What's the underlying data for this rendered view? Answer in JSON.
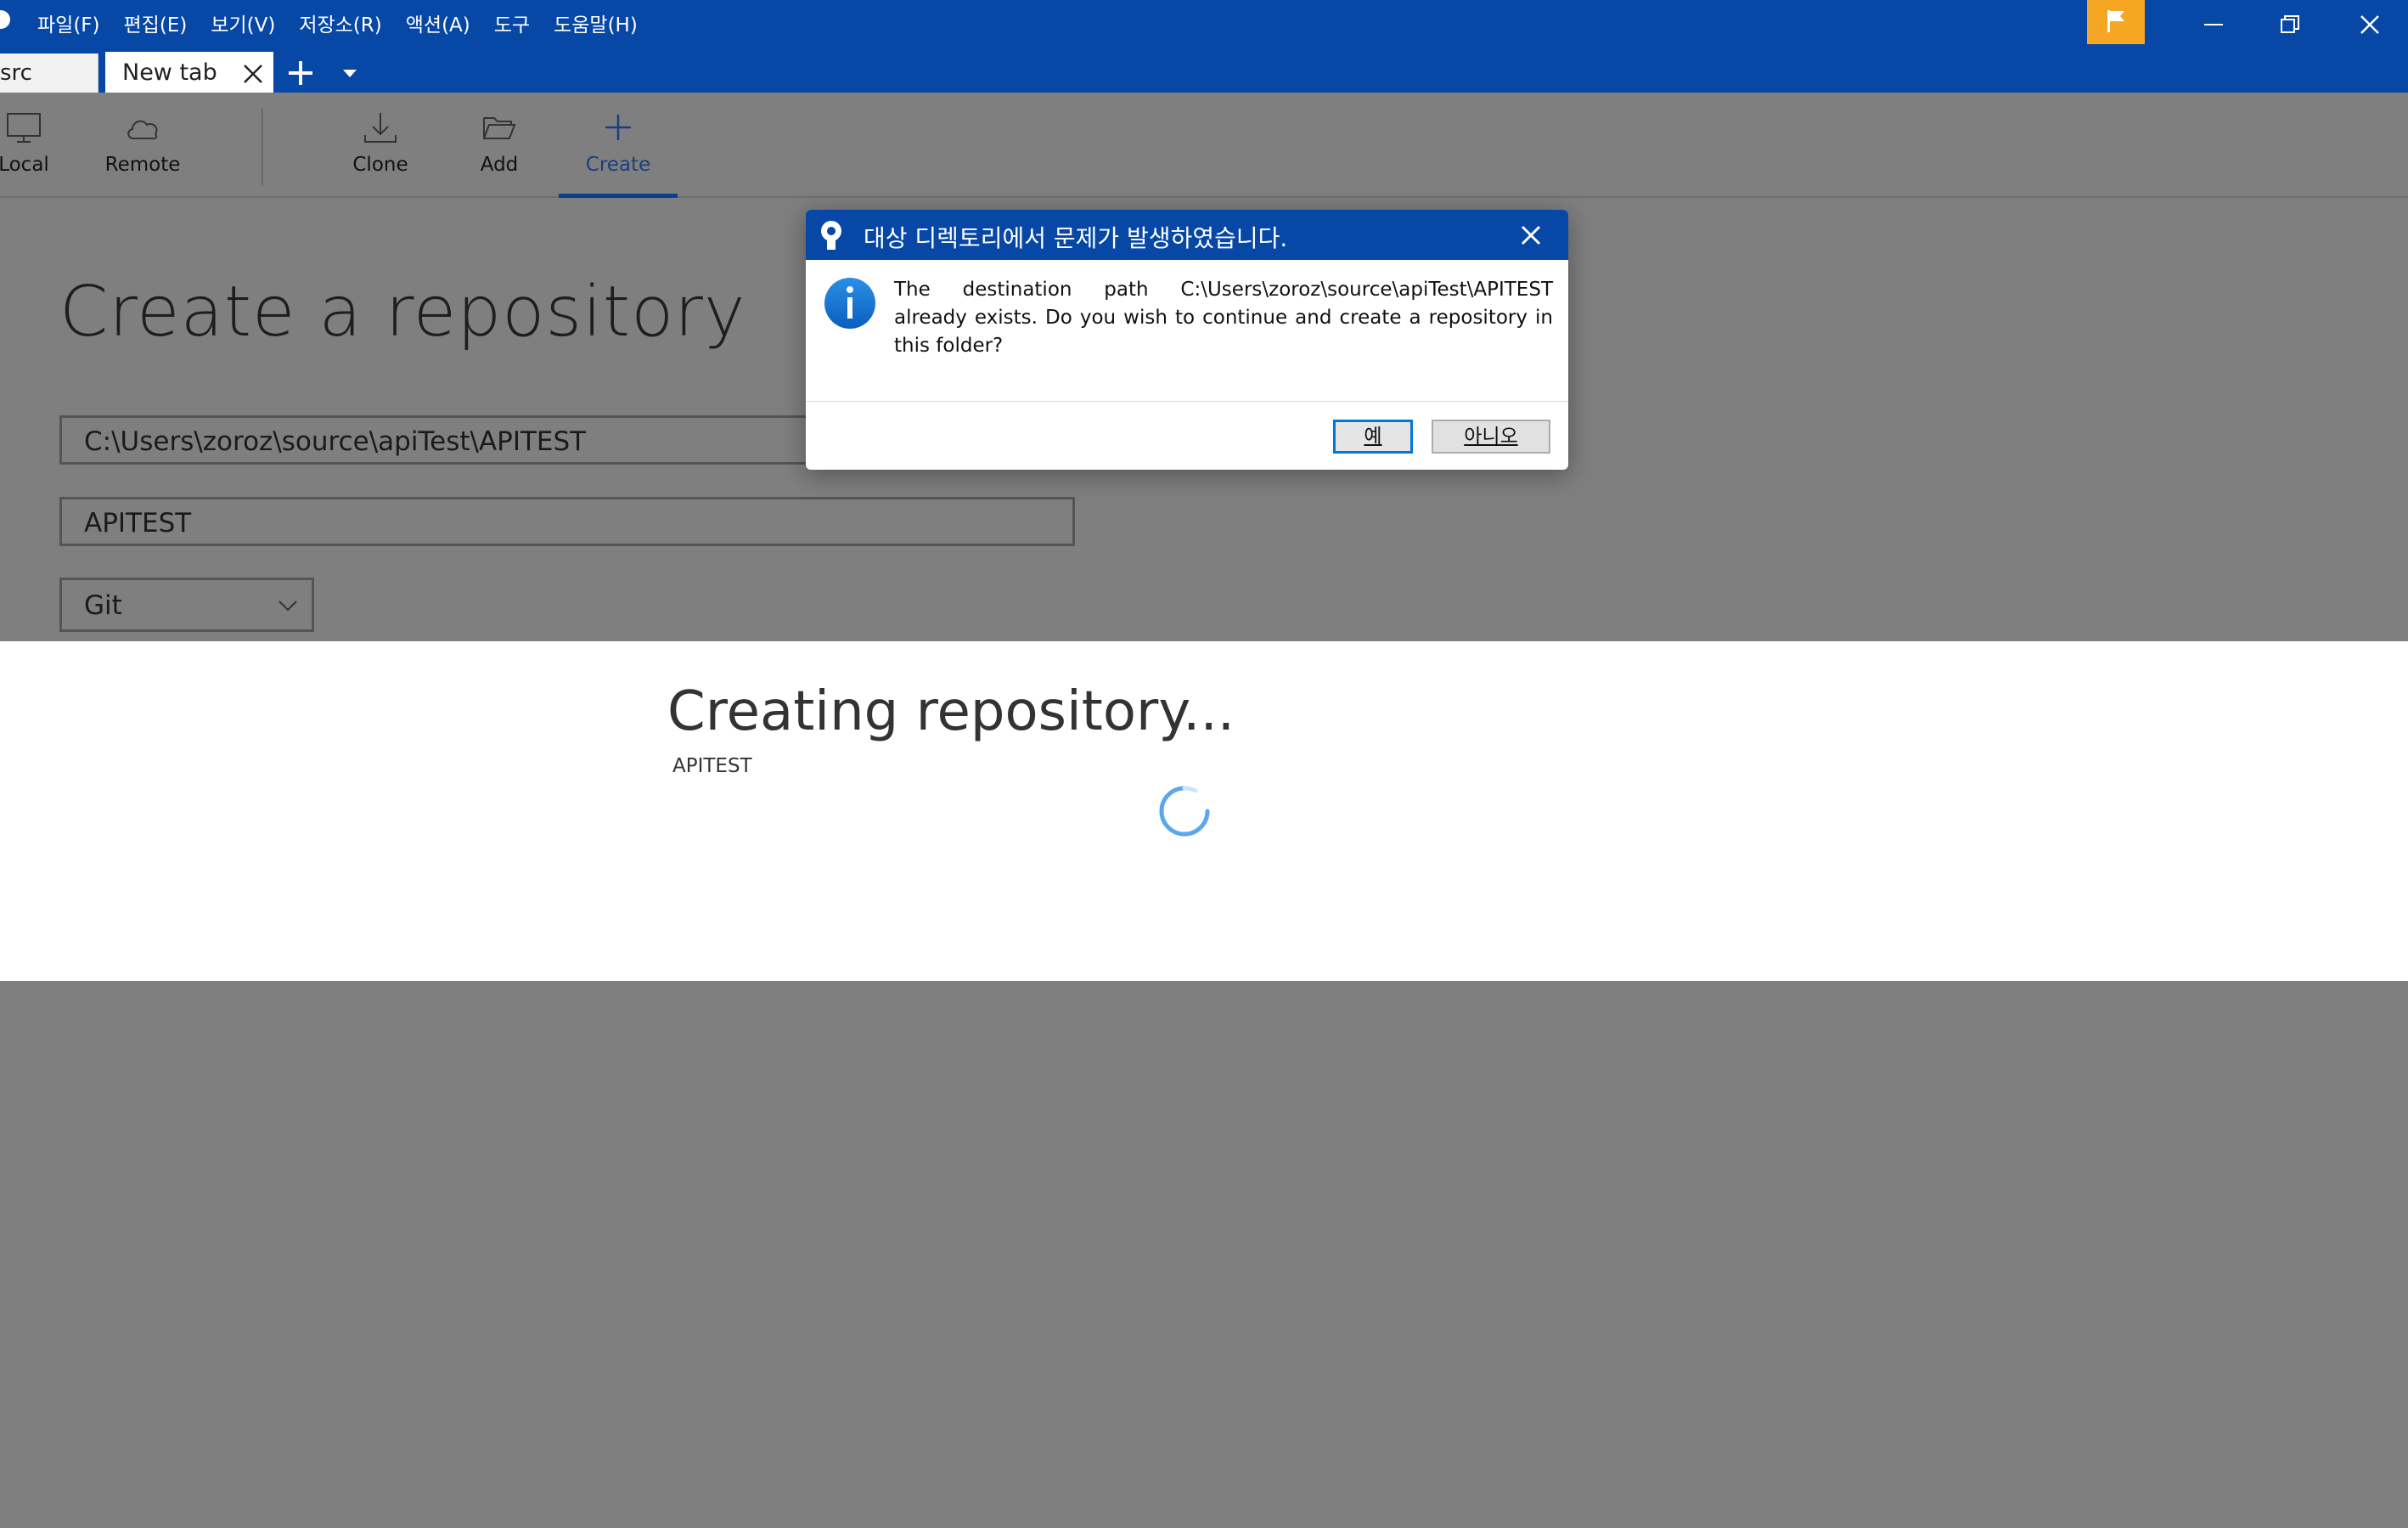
{
  "menu": [
    "파일(F)",
    "편집(E)",
    "보기(V)",
    "저장소(R)",
    "액션(A)",
    "도구",
    "도움말(H)"
  ],
  "tabs": [
    {
      "label": "src"
    },
    {
      "label": "New tab"
    }
  ],
  "toolbar": {
    "local": "Local",
    "remote": "Remote",
    "clone": "Clone",
    "add": "Add",
    "create": "Create"
  },
  "form": {
    "title": "Create a repository",
    "path_value": "C:\\Users\\zoroz\\source\\apiTest\\APITEST",
    "name_value": "APITEST",
    "type_value": "Git"
  },
  "progress": {
    "title": "Creating repository...",
    "name": "APITEST"
  },
  "dialog": {
    "title": "대상 디렉토리에서 문제가 발생하였습니다.",
    "message": "The destination path C:\\Users\\zoroz\\source\\apiTest\\APITEST already exists. Do you wish to continue and create a repository in this folder?",
    "yes_label": "예",
    "no_label": "아니오"
  },
  "colors": {
    "brand": "#0747a6",
    "flag": "#f5a623",
    "accent_focus": "#0078d7"
  }
}
